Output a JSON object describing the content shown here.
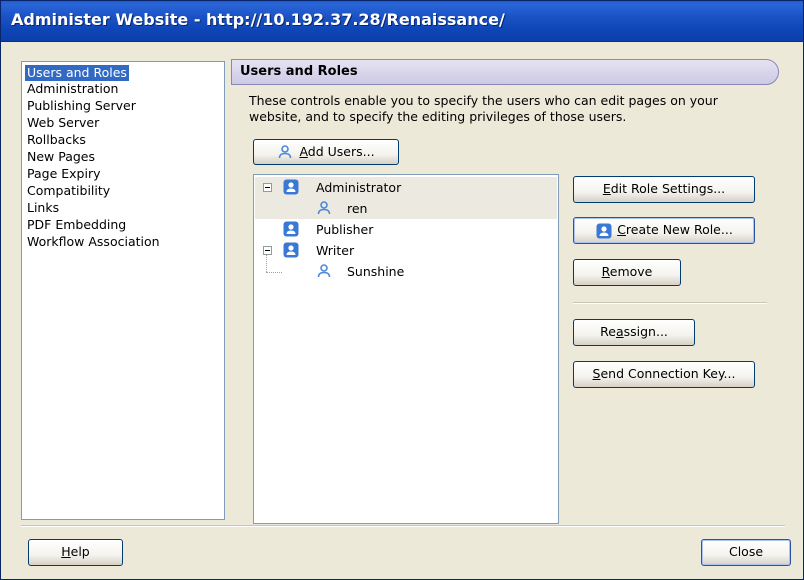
{
  "window": {
    "title": "Administer Website - http://10.192.37.28/Renaissance/"
  },
  "nav": {
    "items": [
      {
        "label": "Users and Roles",
        "selected": true
      },
      {
        "label": "Administration"
      },
      {
        "label": "Publishing Server"
      },
      {
        "label": "Web Server"
      },
      {
        "label": "Rollbacks"
      },
      {
        "label": "New Pages"
      },
      {
        "label": "Page Expiry"
      },
      {
        "label": "Compatibility"
      },
      {
        "label": "Links"
      },
      {
        "label": "PDF Embedding"
      },
      {
        "label": "Workflow Association"
      }
    ]
  },
  "panel": {
    "header": "Users and Roles",
    "description": "These controls enable you to specify the users who can edit pages on your website, and to specify the editing privileges of those users."
  },
  "buttons": {
    "add_users": {
      "pre": "",
      "key": "A",
      "post": "dd Users..."
    },
    "edit_role": {
      "pre": "",
      "key": "E",
      "post": "dit Role Settings..."
    },
    "create_role": {
      "pre": "",
      "key": "C",
      "post": "reate New Role..."
    },
    "remove": {
      "pre": "",
      "key": "R",
      "post": "emove"
    },
    "reassign": {
      "pre": "Re",
      "key": "a",
      "post": "ssign..."
    },
    "send_key": {
      "pre": "",
      "key": "S",
      "post": "end Connection Key..."
    },
    "help": {
      "pre": "",
      "key": "H",
      "post": "elp"
    },
    "close": {
      "label": "Close"
    }
  },
  "tree": {
    "roles": [
      {
        "label": "Administrator",
        "users": [
          "ren"
        ]
      },
      {
        "label": "Publisher",
        "users": []
      },
      {
        "label": "Writer",
        "users": [
          "Sunshine"
        ]
      }
    ]
  },
  "colors": {
    "title_bar": "#0b3fa8",
    "selection": "#316ac5",
    "role_icon": "#3a78d6",
    "user_icon": "#4a8ae0"
  }
}
